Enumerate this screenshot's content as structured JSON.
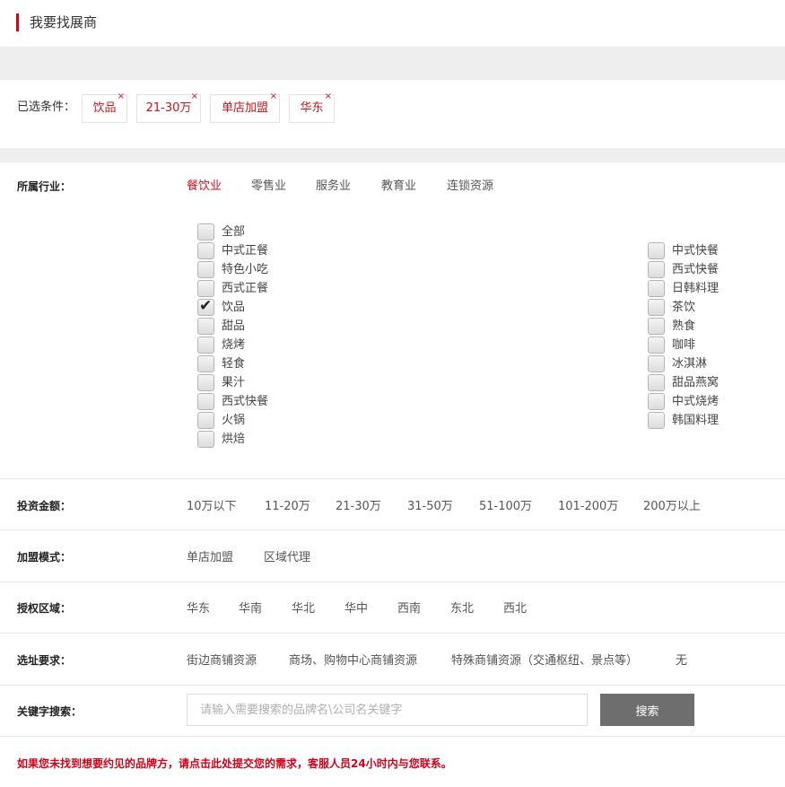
{
  "header": {
    "title": "我要找展商"
  },
  "selected": {
    "label": "已选条件：",
    "remove_symbol": "×",
    "chips": [
      "饮品",
      "21-30万",
      "单店加盟",
      "华东"
    ]
  },
  "industry": {
    "label": "所属行业：",
    "tabs": [
      "餐饮业",
      "零售业",
      "服务业",
      "教育业",
      "连锁资源"
    ],
    "active_tab": "餐饮业",
    "left_checkboxes": [
      {
        "label": "全部",
        "checked": false
      },
      {
        "label": "中式正餐",
        "checked": false
      },
      {
        "label": "特色小吃",
        "checked": false
      },
      {
        "label": "西式正餐",
        "checked": false
      },
      {
        "label": "饮品",
        "checked": true
      },
      {
        "label": "甜品",
        "checked": false
      },
      {
        "label": "烧烤",
        "checked": false
      },
      {
        "label": "轻食",
        "checked": false
      },
      {
        "label": "果汁",
        "checked": false
      },
      {
        "label": "西式快餐",
        "checked": false
      },
      {
        "label": "火锅",
        "checked": false
      },
      {
        "label": "烘焙",
        "checked": false
      }
    ],
    "right_checkboxes": [
      {
        "label": "中式快餐",
        "checked": false
      },
      {
        "label": "西式快餐",
        "checked": false
      },
      {
        "label": "日韩料理",
        "checked": false
      },
      {
        "label": "茶饮",
        "checked": false
      },
      {
        "label": "熟食",
        "checked": false
      },
      {
        "label": "咖啡",
        "checked": false
      },
      {
        "label": "冰淇淋",
        "checked": false
      },
      {
        "label": "甜品燕窝",
        "checked": false
      },
      {
        "label": "中式烧烤",
        "checked": false
      },
      {
        "label": "韩国料理",
        "checked": false
      }
    ]
  },
  "investment": {
    "label": "投资金额：",
    "options": [
      "10万以下",
      "11-20万",
      "21-30万",
      "31-50万",
      "51-100万",
      "101-200万",
      "200万以上"
    ]
  },
  "mode": {
    "label": "加盟模式：",
    "options": [
      "单店加盟",
      "区域代理"
    ]
  },
  "region": {
    "label": "授权区域：",
    "options": [
      "华东",
      "华南",
      "华北",
      "华中",
      "西南",
      "东北",
      "西北"
    ]
  },
  "site": {
    "label": "选址要求：",
    "options": [
      "街边商铺资源",
      "商场、购物中心商铺资源",
      "特殊商铺资源（交通枢纽、景点等）",
      "无"
    ]
  },
  "keyword": {
    "label": "关键字搜索：",
    "placeholder": "请输入需要搜索的品牌名\\公司名关键字",
    "value": "",
    "button": "搜索"
  },
  "footer_note": "如果您未找到想要约见的品牌方，请点击此处提交您的需求，客服人员24小时内与您联系。",
  "colors": {
    "accent": "#d0021b",
    "active": "#c8131f",
    "button": "#6e6e6e"
  }
}
